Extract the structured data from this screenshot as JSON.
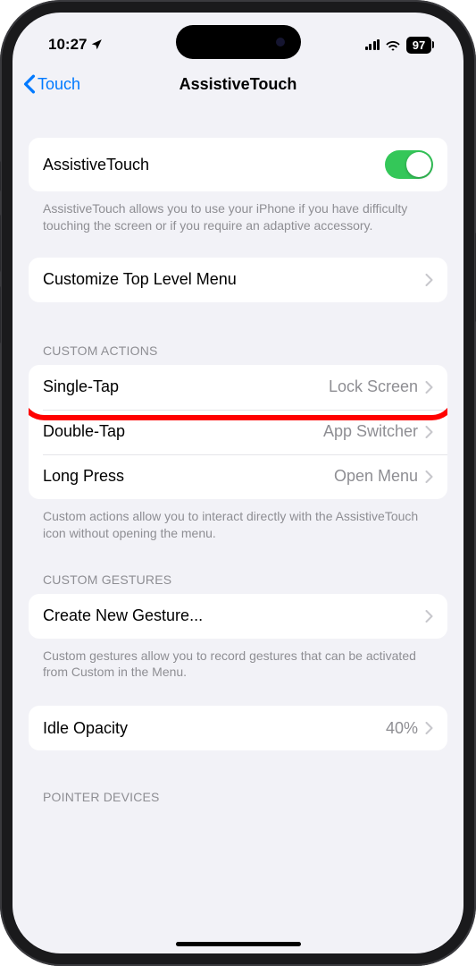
{
  "status": {
    "time": "10:27",
    "battery": "97"
  },
  "nav": {
    "back_label": "Touch",
    "title": "AssistiveTouch"
  },
  "main_toggle": {
    "label": "AssistiveTouch",
    "on": true,
    "footer": "AssistiveTouch allows you to use your iPhone if you have difficulty touching the screen or if you require an adaptive accessory."
  },
  "customize": {
    "label": "Customize Top Level Menu"
  },
  "custom_actions": {
    "header": "CUSTOM ACTIONS",
    "rows": [
      {
        "label": "Single-Tap",
        "value": "Lock Screen"
      },
      {
        "label": "Double-Tap",
        "value": "App Switcher"
      },
      {
        "label": "Long Press",
        "value": "Open Menu"
      }
    ],
    "footer": "Custom actions allow you to interact directly with the AssistiveTouch icon without opening the menu."
  },
  "custom_gestures": {
    "header": "CUSTOM GESTURES",
    "label": "Create New Gesture...",
    "footer": "Custom gestures allow you to record gestures that can be activated from Custom in the Menu."
  },
  "idle_opacity": {
    "label": "Idle Opacity",
    "value": "40%"
  },
  "pointer_devices": {
    "header": "POINTER DEVICES"
  }
}
